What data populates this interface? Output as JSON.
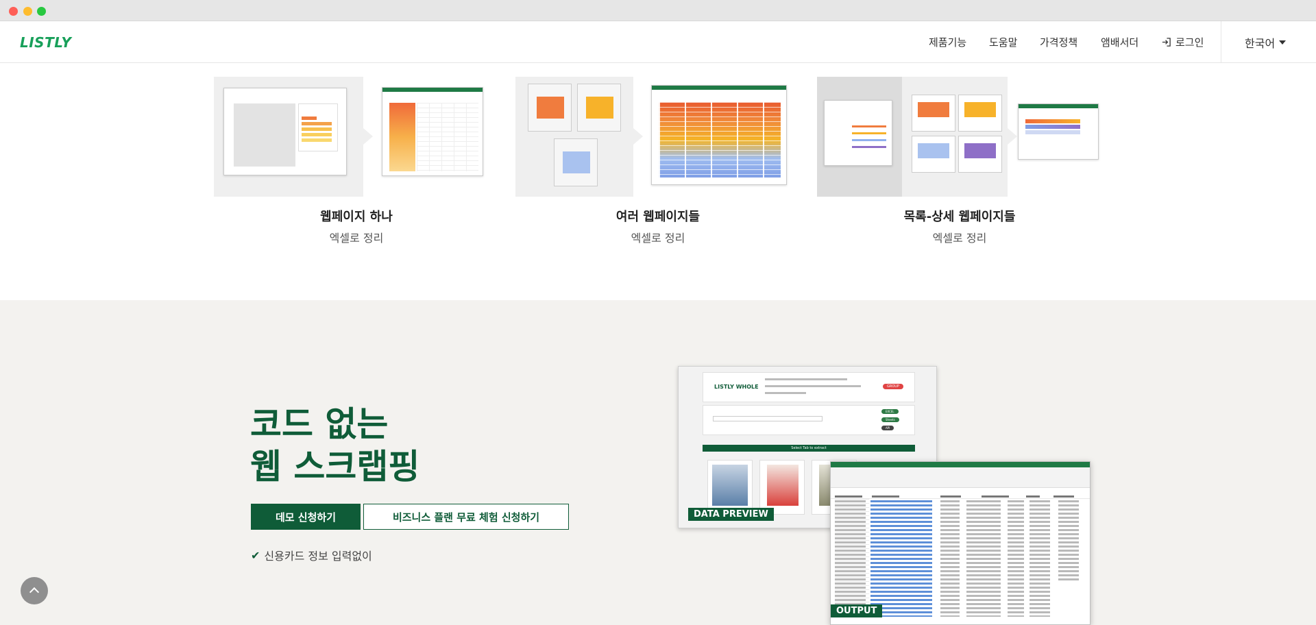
{
  "header": {
    "logo": "LISTLY",
    "nav": [
      {
        "label": "제품기능"
      },
      {
        "label": "도움말"
      },
      {
        "label": "가격정책"
      },
      {
        "label": "앰배서더"
      }
    ],
    "login_label": "로그인",
    "language": "한국어"
  },
  "features": [
    {
      "title": "웹페이지 하나",
      "subtitle": "엑셀로 정리"
    },
    {
      "title": "여러 웹페이지들",
      "subtitle": "엑셀로 정리"
    },
    {
      "title": "목록-상세 웹페이지들",
      "subtitle": "엑셀로 정리"
    }
  ],
  "hero": {
    "title_line1": "코드 없는",
    "title_line2": "웹 스크랩핑",
    "demo_button": "데모 신청하기",
    "trial_button": "비즈니스 플랜 무료 체험 신청하기",
    "note": "신용카드 정보 입력없이"
  },
  "preview": {
    "brand": "LISTLY WHOLE",
    "group_button": "GROUP",
    "excel_button": "EXCEL",
    "sheets_button": "Sheets",
    "api_button": "API",
    "tab_bar": "Select Tab to extract",
    "data_preview_label": "DATA PREVIEW",
    "output_label": "OUTPUT"
  },
  "colors": {
    "brand_green": "#0f5c38",
    "logo_green": "#18a05a",
    "lower_bg": "#f3f2ef"
  }
}
